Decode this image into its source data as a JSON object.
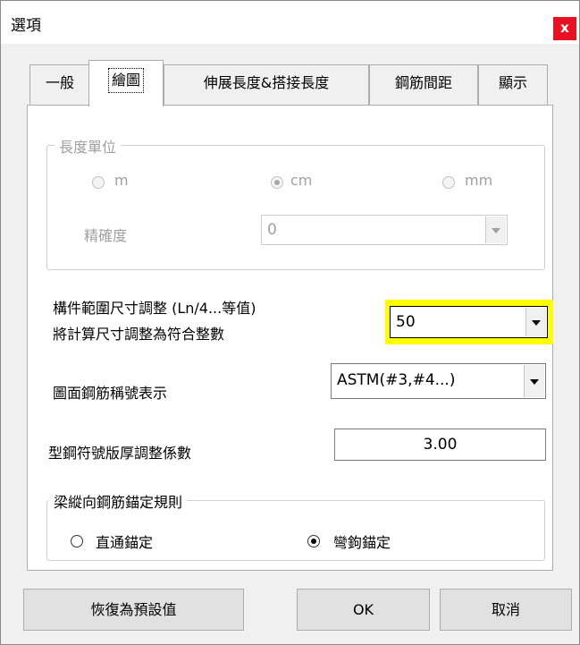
{
  "window": {
    "title": "選項",
    "close_symbol": "x"
  },
  "tabs": [
    {
      "label": "一般",
      "active": false
    },
    {
      "label": "繪圖",
      "active": true
    },
    {
      "label": "伸展長度&搭接長度",
      "active": false
    },
    {
      "label": "鋼筋間距",
      "active": false
    },
    {
      "label": "顯示",
      "active": false
    }
  ],
  "length_unit": {
    "title": "長度單位",
    "options": [
      {
        "label": "m",
        "selected": false
      },
      {
        "label": "cm",
        "selected": true
      },
      {
        "label": "mm",
        "selected": false
      }
    ],
    "precision_label": "精確度",
    "precision_value": "0",
    "enabled": false
  },
  "member_range": {
    "label_line1": "構件範圍尺寸調整 (Ln/4...等值)",
    "label_line2": "將計算尺寸調整為符合整數",
    "value": "50",
    "highlight_color": "#ffff00"
  },
  "rebar_notation": {
    "label": "圖面鋼筋稱號表示",
    "value": "ASTM(#3,#4...)"
  },
  "steel_coef": {
    "label": "型鋼符號版厚調整係數",
    "value": "3.00"
  },
  "beam_anchor": {
    "title": "梁縱向鋼筋錨定規則",
    "options": [
      {
        "label": "直通錨定",
        "selected": false
      },
      {
        "label": "彎鉤錨定",
        "selected": true
      }
    ]
  },
  "buttons": {
    "reset": "恢復為預設值",
    "ok": "OK",
    "cancel": "取消"
  },
  "colors": {
    "close_button": "#e81123",
    "highlight": "#ffff00"
  }
}
